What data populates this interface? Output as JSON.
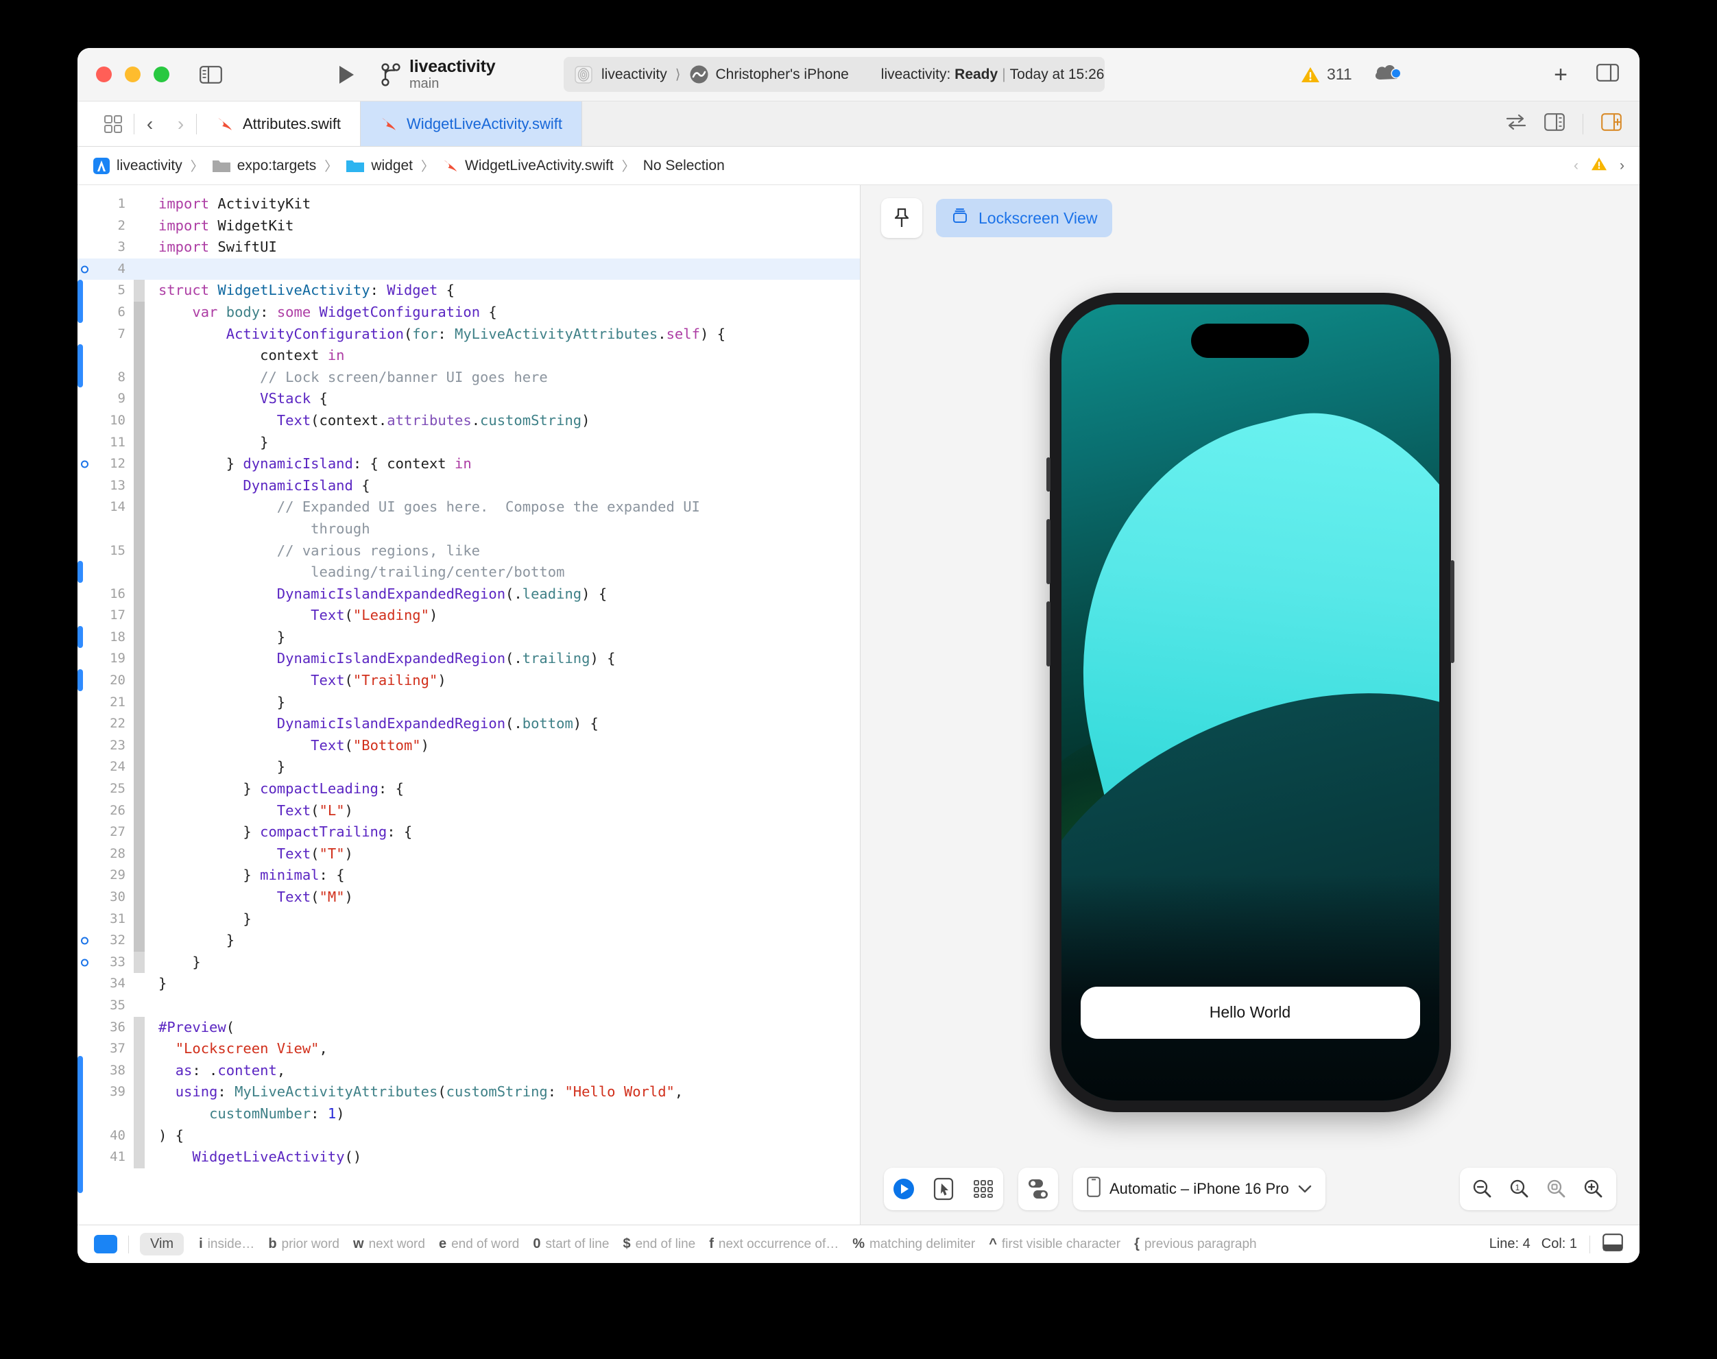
{
  "window": {
    "traffic_lights": [
      "close",
      "minimize",
      "maximize"
    ]
  },
  "toolbar": {
    "scheme_name": "liveactivity",
    "branch": "main",
    "run_label": "run-button",
    "target": "liveactivity",
    "device": "Christopher's iPhone",
    "build_prefix": "liveactivity: ",
    "build_status": "Ready",
    "build_sep": "|",
    "build_time": "Today at 15:26",
    "warning_count": "311",
    "add_label": "+"
  },
  "tabs": [
    {
      "label": "Attributes.swift",
      "active": false
    },
    {
      "label": "WidgetLiveActivity.swift",
      "active": true
    }
  ],
  "breadcrumb": {
    "items": [
      "liveactivity",
      "expo:targets",
      "widget",
      "WidgetLiveActivity.swift",
      "No Selection"
    ],
    "separator": "〉"
  },
  "editor": {
    "lines": [
      {
        "n": "1",
        "tokens": [
          [
            "kw",
            "import"
          ],
          [
            "plain",
            " ActivityKit"
          ]
        ],
        "fold": "none"
      },
      {
        "n": "2",
        "tokens": [
          [
            "kw",
            "import"
          ],
          [
            "plain",
            " WidgetKit"
          ]
        ],
        "fold": "none"
      },
      {
        "n": "3",
        "tokens": [
          [
            "kw",
            "import"
          ],
          [
            "plain",
            " SwiftUI"
          ]
        ],
        "fold": "none"
      },
      {
        "n": "4",
        "tokens": [
          [
            "plain",
            ""
          ]
        ],
        "fold": "none",
        "current": true,
        "dot": true
      },
      {
        "n": "5",
        "tokens": [
          [
            "kw",
            "struct"
          ],
          [
            "plain",
            " "
          ],
          [
            "typ",
            "WidgetLiveActivity"
          ],
          [
            "plain",
            ": "
          ],
          [
            "fn",
            "Widget"
          ],
          [
            "plain",
            " {"
          ]
        ],
        "fold": "g2"
      },
      {
        "n": "6",
        "tokens": [
          [
            "plain",
            "    "
          ],
          [
            "kw",
            "var"
          ],
          [
            "plain",
            " "
          ],
          [
            "typ2",
            "body"
          ],
          [
            "plain",
            ": "
          ],
          [
            "kw",
            "some"
          ],
          [
            "plain",
            " "
          ],
          [
            "fn",
            "WidgetConfiguration"
          ],
          [
            "plain",
            " {"
          ]
        ],
        "fold": "g"
      },
      {
        "n": "7",
        "tokens": [
          [
            "plain",
            "        "
          ],
          [
            "fn",
            "ActivityConfiguration"
          ],
          [
            "plain",
            "("
          ],
          [
            "typ2",
            "for"
          ],
          [
            "plain",
            ": "
          ],
          [
            "typ2",
            "MyLiveActivityAttributes"
          ],
          [
            "plain",
            "."
          ],
          [
            "kw",
            "self"
          ],
          [
            "plain",
            ") {"
          ]
        ],
        "fold": "g"
      },
      {
        "n": "",
        "tokens": [
          [
            "plain",
            "            context "
          ],
          [
            "kw",
            "in"
          ]
        ],
        "fold": "g"
      },
      {
        "n": "8",
        "tokens": [
          [
            "cmt",
            "            // Lock screen/banner UI goes here"
          ]
        ],
        "fold": "g"
      },
      {
        "n": "9",
        "tokens": [
          [
            "plain",
            "            "
          ],
          [
            "fn",
            "VStack"
          ],
          [
            "plain",
            " {"
          ]
        ],
        "fold": "g"
      },
      {
        "n": "10",
        "tokens": [
          [
            "plain",
            "              "
          ],
          [
            "fn",
            "Text"
          ],
          [
            "plain",
            "(context."
          ],
          [
            "prop",
            "attributes"
          ],
          [
            "plain",
            "."
          ],
          [
            "typ2",
            "customString"
          ],
          [
            "plain",
            ")"
          ]
        ],
        "fold": "g"
      },
      {
        "n": "11",
        "tokens": [
          [
            "plain",
            "            }"
          ]
        ],
        "fold": "g"
      },
      {
        "n": "12",
        "tokens": [
          [
            "plain",
            "        } "
          ],
          [
            "fn",
            "dynamicIsland"
          ],
          [
            "plain",
            ": { context "
          ],
          [
            "kw",
            "in"
          ]
        ],
        "fold": "g",
        "dot": true
      },
      {
        "n": "13",
        "tokens": [
          [
            "plain",
            "          "
          ],
          [
            "fn",
            "DynamicIsland"
          ],
          [
            "plain",
            " {"
          ]
        ],
        "fold": "g"
      },
      {
        "n": "14",
        "tokens": [
          [
            "cmt",
            "              // Expanded UI goes here.  Compose the expanded UI"
          ]
        ],
        "fold": "g"
      },
      {
        "n": "",
        "tokens": [
          [
            "cmt",
            "                  through"
          ]
        ],
        "fold": "g"
      },
      {
        "n": "15",
        "tokens": [
          [
            "cmt",
            "              // various regions, like"
          ]
        ],
        "fold": "g"
      },
      {
        "n": "",
        "tokens": [
          [
            "cmt",
            "                  leading/trailing/center/bottom"
          ]
        ],
        "fold": "g"
      },
      {
        "n": "16",
        "tokens": [
          [
            "plain",
            "              "
          ],
          [
            "fn",
            "DynamicIslandExpandedRegion"
          ],
          [
            "plain",
            "(."
          ],
          [
            "typ2",
            "leading"
          ],
          [
            "plain",
            ") {"
          ]
        ],
        "fold": "g"
      },
      {
        "n": "17",
        "tokens": [
          [
            "plain",
            "                  "
          ],
          [
            "fn",
            "Text"
          ],
          [
            "plain",
            "("
          ],
          [
            "str",
            "\"Leading\""
          ],
          [
            "plain",
            ")"
          ]
        ],
        "fold": "g"
      },
      {
        "n": "18",
        "tokens": [
          [
            "plain",
            "              }"
          ]
        ],
        "fold": "g"
      },
      {
        "n": "19",
        "tokens": [
          [
            "plain",
            "              "
          ],
          [
            "fn",
            "DynamicIslandExpandedRegion"
          ],
          [
            "plain",
            "(."
          ],
          [
            "typ2",
            "trailing"
          ],
          [
            "plain",
            ") {"
          ]
        ],
        "fold": "g"
      },
      {
        "n": "20",
        "tokens": [
          [
            "plain",
            "                  "
          ],
          [
            "fn",
            "Text"
          ],
          [
            "plain",
            "("
          ],
          [
            "str",
            "\"Trailing\""
          ],
          [
            "plain",
            ")"
          ]
        ],
        "fold": "g"
      },
      {
        "n": "21",
        "tokens": [
          [
            "plain",
            "              }"
          ]
        ],
        "fold": "g"
      },
      {
        "n": "22",
        "tokens": [
          [
            "plain",
            "              "
          ],
          [
            "fn",
            "DynamicIslandExpandedRegion"
          ],
          [
            "plain",
            "(."
          ],
          [
            "typ2",
            "bottom"
          ],
          [
            "plain",
            ") {"
          ]
        ],
        "fold": "g"
      },
      {
        "n": "23",
        "tokens": [
          [
            "plain",
            "                  "
          ],
          [
            "fn",
            "Text"
          ],
          [
            "plain",
            "("
          ],
          [
            "str",
            "\"Bottom\""
          ],
          [
            "plain",
            ")"
          ]
        ],
        "fold": "g"
      },
      {
        "n": "24",
        "tokens": [
          [
            "plain",
            "              }"
          ]
        ],
        "fold": "g"
      },
      {
        "n": "25",
        "tokens": [
          [
            "plain",
            "          } "
          ],
          [
            "fn",
            "compactLeading"
          ],
          [
            "plain",
            ": {"
          ]
        ],
        "fold": "g"
      },
      {
        "n": "26",
        "tokens": [
          [
            "plain",
            "              "
          ],
          [
            "fn",
            "Text"
          ],
          [
            "plain",
            "("
          ],
          [
            "str",
            "\"L\""
          ],
          [
            "plain",
            ")"
          ]
        ],
        "fold": "g"
      },
      {
        "n": "27",
        "tokens": [
          [
            "plain",
            "          } "
          ],
          [
            "fn",
            "compactTrailing"
          ],
          [
            "plain",
            ": {"
          ]
        ],
        "fold": "g"
      },
      {
        "n": "28",
        "tokens": [
          [
            "plain",
            "              "
          ],
          [
            "fn",
            "Text"
          ],
          [
            "plain",
            "("
          ],
          [
            "str",
            "\"T\""
          ],
          [
            "plain",
            ")"
          ]
        ],
        "fold": "g"
      },
      {
        "n": "29",
        "tokens": [
          [
            "plain",
            "          } "
          ],
          [
            "fn",
            "minimal"
          ],
          [
            "plain",
            ": {"
          ]
        ],
        "fold": "g"
      },
      {
        "n": "30",
        "tokens": [
          [
            "plain",
            "              "
          ],
          [
            "fn",
            "Text"
          ],
          [
            "plain",
            "("
          ],
          [
            "str",
            "\"M\""
          ],
          [
            "plain",
            ")"
          ]
        ],
        "fold": "g"
      },
      {
        "n": "31",
        "tokens": [
          [
            "plain",
            "          }"
          ]
        ],
        "fold": "g"
      },
      {
        "n": "32",
        "tokens": [
          [
            "plain",
            "        }"
          ]
        ],
        "fold": "g",
        "dot": true
      },
      {
        "n": "33",
        "tokens": [
          [
            "plain",
            "    }"
          ]
        ],
        "fold": "g2",
        "dot": true
      },
      {
        "n": "34",
        "tokens": [
          [
            "plain",
            "}"
          ]
        ],
        "fold": "none"
      },
      {
        "n": "35",
        "tokens": [
          [
            "plain",
            ""
          ]
        ],
        "fold": "none"
      },
      {
        "n": "36",
        "tokens": [
          [
            "fn",
            "#Preview"
          ],
          [
            "plain",
            "("
          ]
        ],
        "fold": "g2"
      },
      {
        "n": "37",
        "tokens": [
          [
            "plain",
            "  "
          ],
          [
            "str",
            "\"Lockscreen View\""
          ],
          [
            "plain",
            ","
          ]
        ],
        "fold": "g2"
      },
      {
        "n": "38",
        "tokens": [
          [
            "plain",
            "  "
          ],
          [
            "fn",
            "as"
          ],
          [
            "plain",
            ": ."
          ],
          [
            "fn",
            "content"
          ],
          [
            "plain",
            ","
          ]
        ],
        "fold": "g2"
      },
      {
        "n": "39",
        "tokens": [
          [
            "plain",
            "  "
          ],
          [
            "fn",
            "using"
          ],
          [
            "plain",
            ": "
          ],
          [
            "typ2",
            "MyLiveActivityAttributes"
          ],
          [
            "plain",
            "("
          ],
          [
            "typ2",
            "customString"
          ],
          [
            "plain",
            ": "
          ],
          [
            "str",
            "\"Hello World\""
          ],
          [
            "plain",
            ","
          ]
        ],
        "fold": "g2"
      },
      {
        "n": "",
        "tokens": [
          [
            "plain",
            "      "
          ],
          [
            "typ2",
            "customNumber"
          ],
          [
            "plain",
            ": "
          ],
          [
            "num",
            "1"
          ],
          [
            "plain",
            ")"
          ]
        ],
        "fold": "g2"
      },
      {
        "n": "40",
        "tokens": [
          [
            "plain",
            ") {"
          ]
        ],
        "fold": "g2"
      },
      {
        "n": "41",
        "tokens": [
          [
            "plain",
            "    "
          ],
          [
            "fn",
            "WidgetLiveActivity"
          ],
          [
            "plain",
            "()"
          ]
        ],
        "fold": "g2"
      }
    ]
  },
  "preview": {
    "pin_icon": "pin-icon",
    "tab_label": "Lockscreen View",
    "device_label": "Automatic – iPhone 16 Pro",
    "live_activity_text": "Hello World",
    "zoom_buttons": [
      "zoom-out",
      "zoom-actual-size",
      "zoom-to-fit",
      "zoom-in"
    ],
    "controls": [
      "play-preview",
      "select-mode",
      "variants-grid",
      "device-settings"
    ]
  },
  "statusbar": {
    "mode": "Vim",
    "hints": [
      {
        "key": "i",
        "label": "inside…"
      },
      {
        "key": "b",
        "label": "prior word"
      },
      {
        "key": "w",
        "label": "next word"
      },
      {
        "key": "e",
        "label": "end of word"
      },
      {
        "key": "0",
        "label": "start of line"
      },
      {
        "key": "$",
        "label": "end of line"
      },
      {
        "key": "f",
        "label": "next occurrence of…"
      },
      {
        "key": "%",
        "label": "matching delimiter"
      },
      {
        "key": "^",
        "label": "first visible character"
      },
      {
        "key": "{",
        "label": "previous paragraph"
      }
    ],
    "line_label": "Line: 4",
    "col_label": "Col: 1"
  },
  "colors": {
    "accent_blue": "#1767d8",
    "active_tab_bg": "#cfe2fb",
    "warning_yellow": "#f5b000",
    "string_red": "#d12f1b",
    "keyword_magenta": "#ad3da4"
  }
}
